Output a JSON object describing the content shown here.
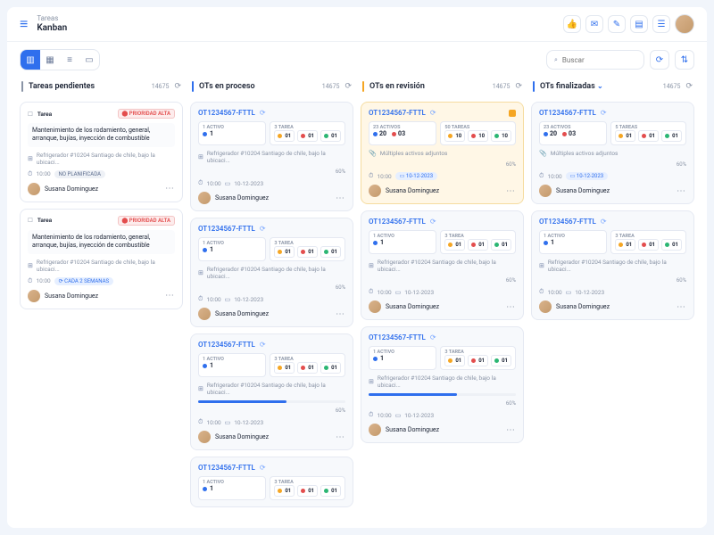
{
  "crumb": {
    "parent": "Tareas",
    "current": "Kanban"
  },
  "search": {
    "placeholder": "Buscar"
  },
  "columns": [
    {
      "color": "#8a94a6",
      "title": "Tareas pendientes",
      "count": "14675"
    },
    {
      "color": "#2F6FED",
      "title": "OTs en proceso",
      "count": "14675"
    },
    {
      "color": "#f5a623",
      "title": "OTs en revisión",
      "count": "14675"
    },
    {
      "color": "#2F6FED",
      "title": "OTs finalizadas",
      "count": "14675",
      "dropdown": true
    }
  ],
  "task": {
    "tag": "Tarea",
    "priority": "PRIORIDAD ALTA",
    "desc": "Mantenimiento de los rodamiento, general, arranque, bujías, inyección de combustible",
    "asset": "Refrigerador #10204 Santiago de chile, bajo la ubicaci...",
    "time": "10:00",
    "recur": "NO PLANIFICADA",
    "recur2": "CADA 2 SEMANAS",
    "user": "Susana Dominguez"
  },
  "ot": {
    "code": "OT1234567-FTTL",
    "activos": "1 ACTIVO",
    "activosN": "1",
    "tareas": "3 TAREA",
    "tareasN": "3",
    "m01": "01",
    "asset": "Refrigerador #10204 Santiago de chile, bajo la ubicaci...",
    "multi": "Múltiples activos adjuntos",
    "pct": "60%",
    "time": "10:00",
    "date": "10-12-2023",
    "user": "Susana Dominguez",
    "big": {
      "activos": "23 ACTIVOS",
      "tareas": "50 TAREAS",
      "a": "20",
      "b": "03",
      "c": "10",
      "d": "10",
      "e": "10"
    }
  }
}
